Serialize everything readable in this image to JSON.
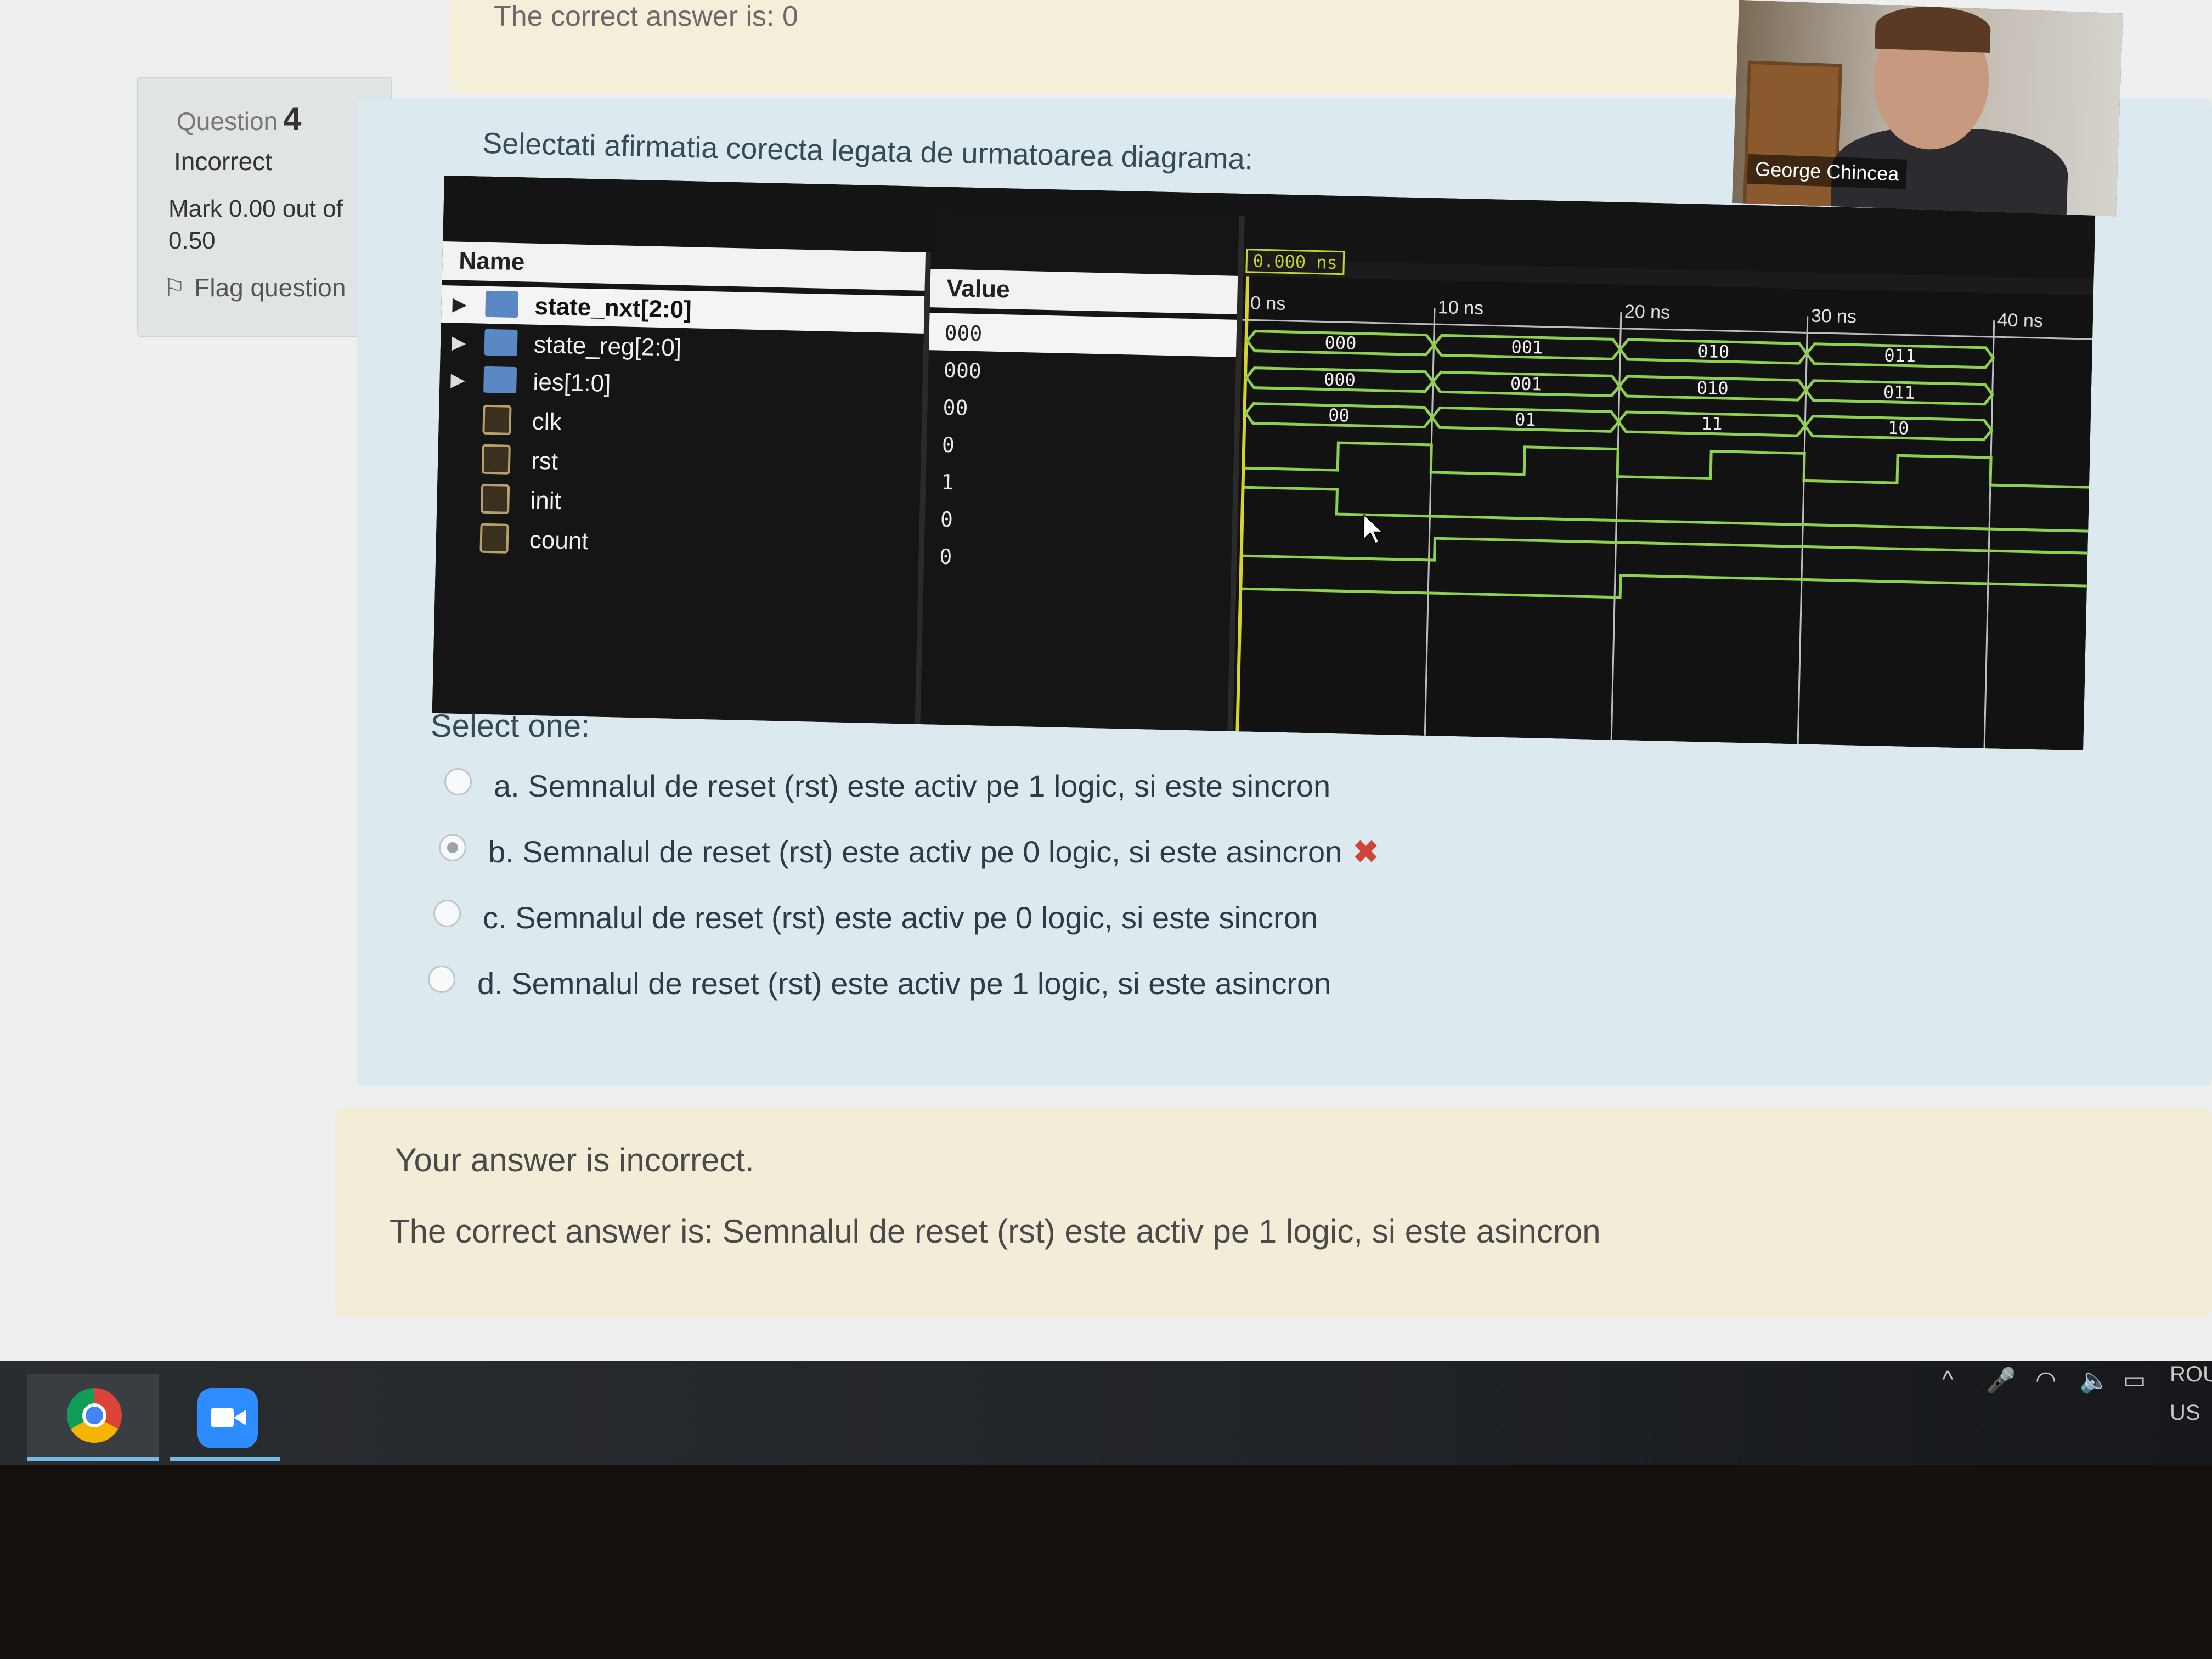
{
  "top_feedback": {
    "text": "The correct answer is: 0"
  },
  "question_info": {
    "label": "Question",
    "number": "4",
    "state": "Incorrect",
    "mark": "Mark 0.00 out of 0.50",
    "flag": "Flag question"
  },
  "question": {
    "text": "Selectati afirmatia corecta legata de urmatoarea diagrama:",
    "select_one": "Select one:",
    "options": [
      {
        "label": "a. Semnalul de reset (rst) este activ pe 1 logic, si este sincron",
        "checked": false,
        "wrong": ""
      },
      {
        "label": "b. Semnalul de reset (rst) este activ pe 0 logic, si este asincron",
        "checked": true,
        "wrong": "✖"
      },
      {
        "label": "c. Semnalul de reset (rst) este activ pe 0 logic, si este sincron",
        "checked": false,
        "wrong": ""
      },
      {
        "label": "d. Semnalul de reset (rst) este activ pe 1 logic, si este asincron",
        "checked": false,
        "wrong": ""
      }
    ]
  },
  "diagram": {
    "cursor_time": "0.000 ns",
    "name_header": "Name",
    "value_header": "Value",
    "signals": [
      {
        "name": "state_nxt[2:0]",
        "value": "000",
        "kind": "bus"
      },
      {
        "name": "state_reg[2:0]",
        "value": "000",
        "kind": "bus"
      },
      {
        "name": "ies[1:0]",
        "value": "00",
        "kind": "bus"
      },
      {
        "name": "clk",
        "value": "0",
        "kind": "bit"
      },
      {
        "name": "rst",
        "value": "1",
        "kind": "bit"
      },
      {
        "name": "init",
        "value": "0",
        "kind": "bit"
      },
      {
        "name": "count",
        "value": "0",
        "kind": "bit"
      }
    ],
    "time_marks": [
      "0 ns",
      "10 ns",
      "20 ns",
      "30 ns",
      "40 ns"
    ],
    "waves": {
      "state_nxt": [
        "000",
        "001",
        "010",
        "011"
      ],
      "state_reg": [
        "000",
        "001",
        "010",
        "011"
      ],
      "ies": [
        "00",
        "01",
        "11",
        "10"
      ]
    },
    "wave_color": "#8fd14f"
  },
  "feedback": {
    "line1": "Your answer is incorrect.",
    "line2": "The correct answer is: Semnalul de reset (rst) este activ pe 1 logic, si este asincron"
  },
  "video": {
    "name": "George Chincea"
  },
  "taskbar": {
    "apps": [
      "chrome-icon",
      "zoom-icon"
    ],
    "lang_top": "ROU",
    "lang_bottom": "US"
  }
}
